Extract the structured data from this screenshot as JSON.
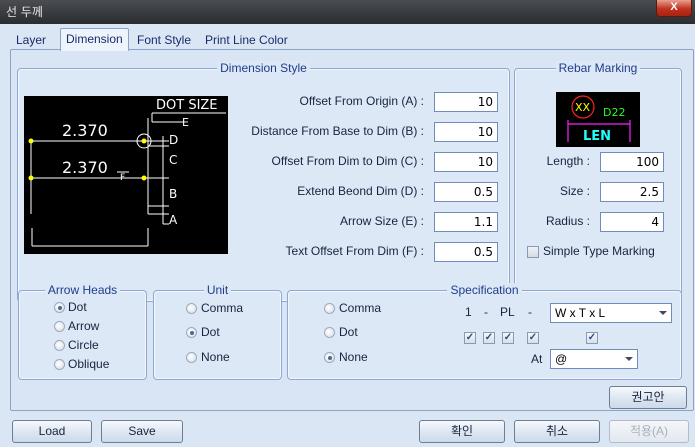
{
  "window": {
    "title": "선 두께",
    "close_label": "X"
  },
  "tabs": [
    {
      "label": "Layer",
      "active": false
    },
    {
      "label": "Dimension",
      "active": true
    },
    {
      "label": "Font Style",
      "active": false
    },
    {
      "label": "Print Line Color",
      "active": false
    }
  ],
  "dimension_style": {
    "legend": "Dimension Style",
    "preview": {
      "header": "DOT SIZE",
      "value_top": "2.370",
      "value_bottom": "2.370",
      "letters": [
        "E",
        "D",
        "C",
        "B",
        "A",
        "F"
      ]
    },
    "fields": [
      {
        "label": "Offset From Origin (A) :",
        "value": "10"
      },
      {
        "label": "Distance From Base to Dim (B) :",
        "value": "10"
      },
      {
        "label": "Offset From Dim to Dim (C) :",
        "value": "10"
      },
      {
        "label": "Extend Beond Dim (D) :",
        "value": "0.5"
      },
      {
        "label": "Arrow Size (E) :",
        "value": "1.1"
      },
      {
        "label": "Text Offset From Dim (F) :",
        "value": "0.5"
      }
    ]
  },
  "rebar_marking": {
    "legend": "Rebar Marking",
    "preview": {
      "circle_text": "XX",
      "code_text": "D22",
      "len_text": "LEN"
    },
    "fields": [
      {
        "label": "Length :",
        "value": "100"
      },
      {
        "label": "Size :",
        "value": "2.5"
      },
      {
        "label": "Radius :",
        "value": "4"
      }
    ],
    "simple_type_label": "Simple Type Marking",
    "simple_type_checked": false
  },
  "arrow_heads": {
    "legend": "Arrow Heads",
    "options": [
      "Dot",
      "Arrow",
      "Circle",
      "Oblique"
    ],
    "selected": "Dot"
  },
  "unit": {
    "legend": "Unit",
    "options": [
      "Comma",
      "Dot",
      "None"
    ],
    "selected": "Dot"
  },
  "specification": {
    "legend": "Specification",
    "options": [
      "Comma",
      "Dot",
      "None"
    ],
    "selected": "None",
    "pattern_1": "1",
    "dash_1": "-",
    "pattern_pl": "PL",
    "dash_2": "-",
    "format_value": "W x T x L",
    "checks": [
      true,
      true,
      true,
      true,
      true
    ],
    "at_label": "At",
    "at_value": "@"
  },
  "buttons": {
    "recommend": "권고안",
    "load": "Load",
    "save": "Save",
    "ok": "확인",
    "cancel": "취소",
    "apply": "적용(A)"
  },
  "colors": {
    "accent": "#1e3c8c",
    "preview_bg": "#000000",
    "dim_line": "#ffffff",
    "dot_yellow": "#ffff00",
    "rebar_red": "#ff2020",
    "rebar_green": "#20ff20",
    "rebar_magenta": "#ff20ff",
    "rebar_cyan": "#20ffff"
  }
}
